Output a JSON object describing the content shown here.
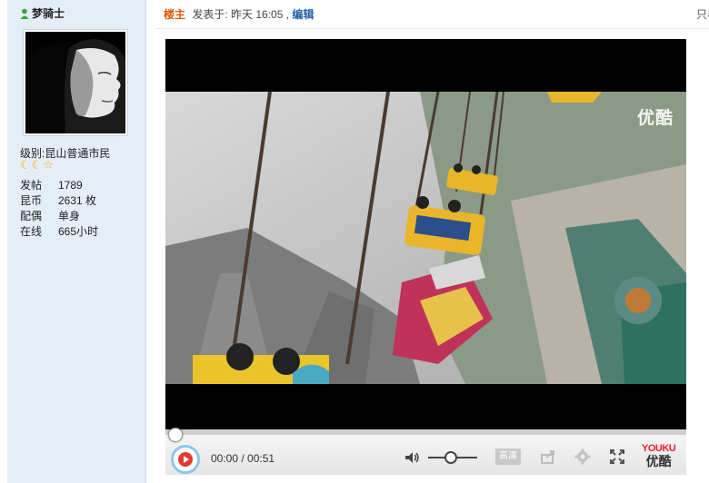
{
  "user": {
    "name": "梦骑士",
    "level_label": "级别:",
    "level_value": "昆山普通市民",
    "stats": [
      {
        "key": "发帖",
        "value": "1789"
      },
      {
        "key": "昆币",
        "value": "2631 枚"
      },
      {
        "key": "配偶",
        "value": "单身"
      },
      {
        "key": "在线",
        "value": "665小时"
      }
    ]
  },
  "post": {
    "owner_tag": "楼主",
    "posted_label": "发表于: 昨天 16:05 ,",
    "edit_link": "编辑",
    "only_link": "只看"
  },
  "video": {
    "watermark": "优酷",
    "timecode": "00:00 / 00:51",
    "quality_label": "高清",
    "progress_fraction": 0,
    "volume_fraction": 0.45,
    "logo_en": "YOUKU",
    "logo_zh": "优酷"
  },
  "colors": {
    "sidebar_bg": "#e5edf7",
    "owner_tag": "#e05a00",
    "link": "#225fa8",
    "play_red": "#e23b2e",
    "youku_red": "#e8222e"
  },
  "icons": [
    "user-icon",
    "moon-icon",
    "star-icon",
    "play-icon",
    "volume-icon",
    "share-icon",
    "gear-icon",
    "fullscreen-icon"
  ]
}
